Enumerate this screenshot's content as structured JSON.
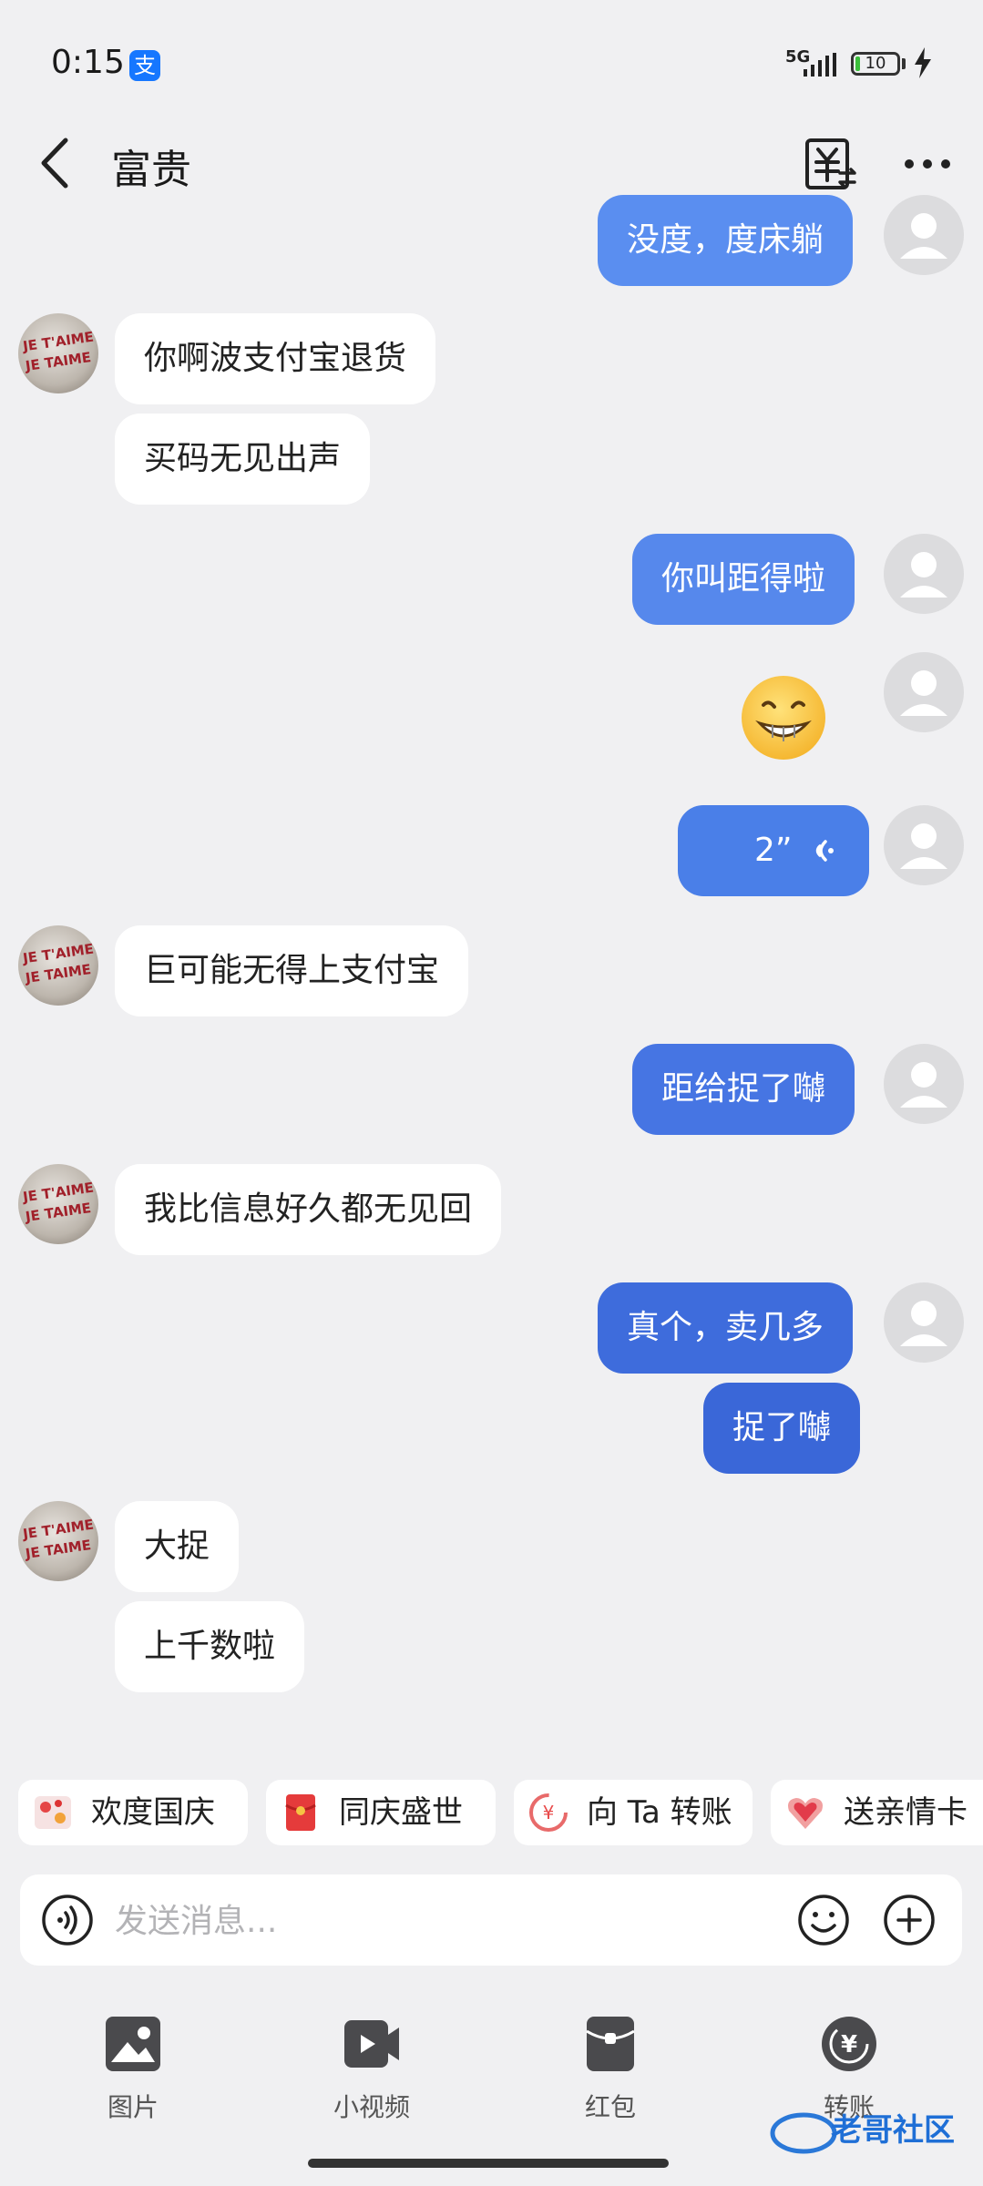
{
  "status_bar": {
    "time": "0:15",
    "app_badge": "支",
    "network": "5G",
    "battery": "10"
  },
  "header": {
    "title": "富贵"
  },
  "messages": [
    {
      "side": "out",
      "text": "没度，度床躺",
      "color": "#5a8ef0"
    },
    {
      "side": "in",
      "text": "你啊波支付宝退货"
    },
    {
      "side": "in",
      "text": "买码无见出声"
    },
    {
      "side": "out",
      "text": "你叫距得啦",
      "color": "#5688ec"
    },
    {
      "side": "out",
      "type": "emoji",
      "text": "😁"
    },
    {
      "side": "out",
      "type": "voice",
      "text": "2”",
      "color": "#4a7fe8"
    },
    {
      "side": "in",
      "text": "巨可能无得上支付宝"
    },
    {
      "side": "out",
      "text": "距给捉了嚹",
      "color": "#4675e3"
    },
    {
      "side": "in",
      "text": "我比信息好久都无见回"
    },
    {
      "side": "out",
      "text": "真个，卖几多",
      "color": "#3e6cdc"
    },
    {
      "side": "out",
      "text": "捉了嚹",
      "color": "#3a67d8"
    },
    {
      "side": "in",
      "text": "大捉"
    },
    {
      "side": "in",
      "text": "上千数啦"
    }
  ],
  "quick_actions": [
    "欢度国庆",
    "同庆盛世",
    "向 Ta 转账",
    "送亲情卡"
  ],
  "input": {
    "placeholder": "发送消息..."
  },
  "toolbar": [
    "图片",
    "小视频",
    "红包",
    "转账"
  ],
  "avatar_text": [
    "JE T'AIME",
    "JE TAIME"
  ],
  "watermark_text": "老哥社区",
  "colors": {
    "background": "#f0f0f2",
    "accent": "#1677ff"
  }
}
